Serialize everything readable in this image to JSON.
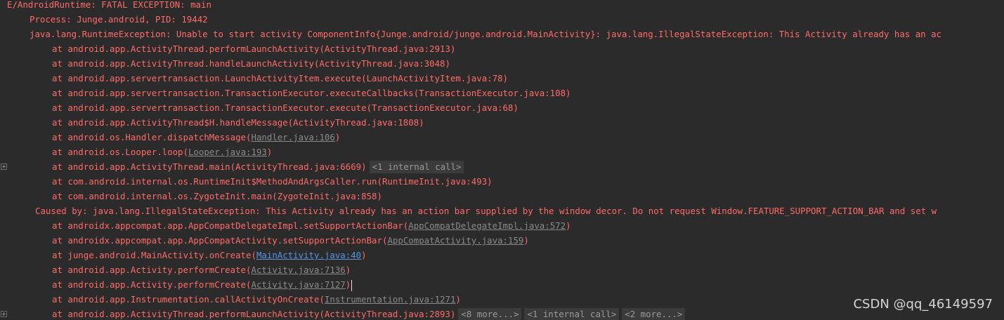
{
  "log": {
    "header": "E/AndroidRuntime: FATAL EXCEPTION: main",
    "process": "Process: Junge.android, PID: 19442",
    "exception": "java.lang.RuntimeException: Unable to start activity ComponentInfo{Junge.android/junge.android.MainActivity}: java.lang.IllegalStateException: This Activity already has an ac",
    "trace": [
      {
        "prefix": "at android.app.ActivityThread.performLaunchActivity(ActivityThread.java:2913)"
      },
      {
        "prefix": "at android.app.ActivityThread.handleLaunchActivity(ActivityThread.java:3048)"
      },
      {
        "prefix": "at android.app.servertransaction.LaunchActivityItem.execute(LaunchActivityItem.java:78)"
      },
      {
        "prefix": "at android.app.servertransaction.TransactionExecutor.executeCallbacks(TransactionExecutor.java:108)"
      },
      {
        "prefix": "at android.app.servertransaction.TransactionExecutor.execute(TransactionExecutor.java:68)"
      },
      {
        "prefix": "at android.app.ActivityThread$H.handleMessage(ActivityThread.java:1808)"
      },
      {
        "prefix": "at android.os.Handler.dispatchMessage(",
        "link": "Handler.java:106",
        "suffix": ")"
      },
      {
        "prefix": "at android.os.Looper.loop(",
        "link": "Looper.java:193",
        "suffix": ")"
      },
      {
        "prefix": "at android.app.ActivityThread.main(ActivityThread.java:6669)",
        "fold": "<1 internal call>"
      },
      {
        "prefix": "at com.android.internal.os.RuntimeInit$MethodAndArgsCaller.run(RuntimeInit.java:493)"
      },
      {
        "prefix": "at com.android.internal.os.ZygoteInit.main(ZygoteInit.java:858)"
      }
    ],
    "caused_by": "Caused by: java.lang.IllegalStateException: This Activity already has an action bar supplied by the window decor. Do not request Window.FEATURE_SUPPORT_ACTION_BAR and set w",
    "cause_trace": [
      {
        "prefix": "at androidx.appcompat.app.AppCompatDelegateImpl.setSupportActionBar(",
        "link": "AppCompatDelegateImpl.java:572",
        "suffix": ")"
      },
      {
        "prefix": "at androidx.appcompat.app.AppCompatActivity.setSupportActionBar(",
        "link": "AppCompatActivity.java:159",
        "suffix": ")"
      },
      {
        "prefix": "at junge.android.MainActivity.onCreate(",
        "link": "MainActivity.java:40",
        "suffix": ")"
      },
      {
        "prefix": "at android.app.Activity.performCreate(",
        "link": "Activity.java:7136",
        "suffix": ")"
      },
      {
        "prefix": "at android.app.Activity.performCreate(",
        "link": "Activity.java:7127",
        "suffix": ")"
      },
      {
        "prefix": "at android.app.Instrumentation.callActivityOnCreate(",
        "link": "Instrumentation.java:1271",
        "suffix": ")"
      },
      {
        "prefix": "at android.app.ActivityThread.performLaunchActivity(ActivityThread.java:2893)",
        "fold1": "<8 more...>",
        "fold2": "<1 internal call>",
        "fold3": "<2 more...>"
      }
    ]
  },
  "watermark": "CSDN @qq_46149597",
  "colors": {
    "background": "#2b2b2b",
    "error_text": "#ff6b68",
    "file_link": "#8a8a8a",
    "project_link": "#5894e0",
    "fold_bg": "#3b3b3b"
  }
}
